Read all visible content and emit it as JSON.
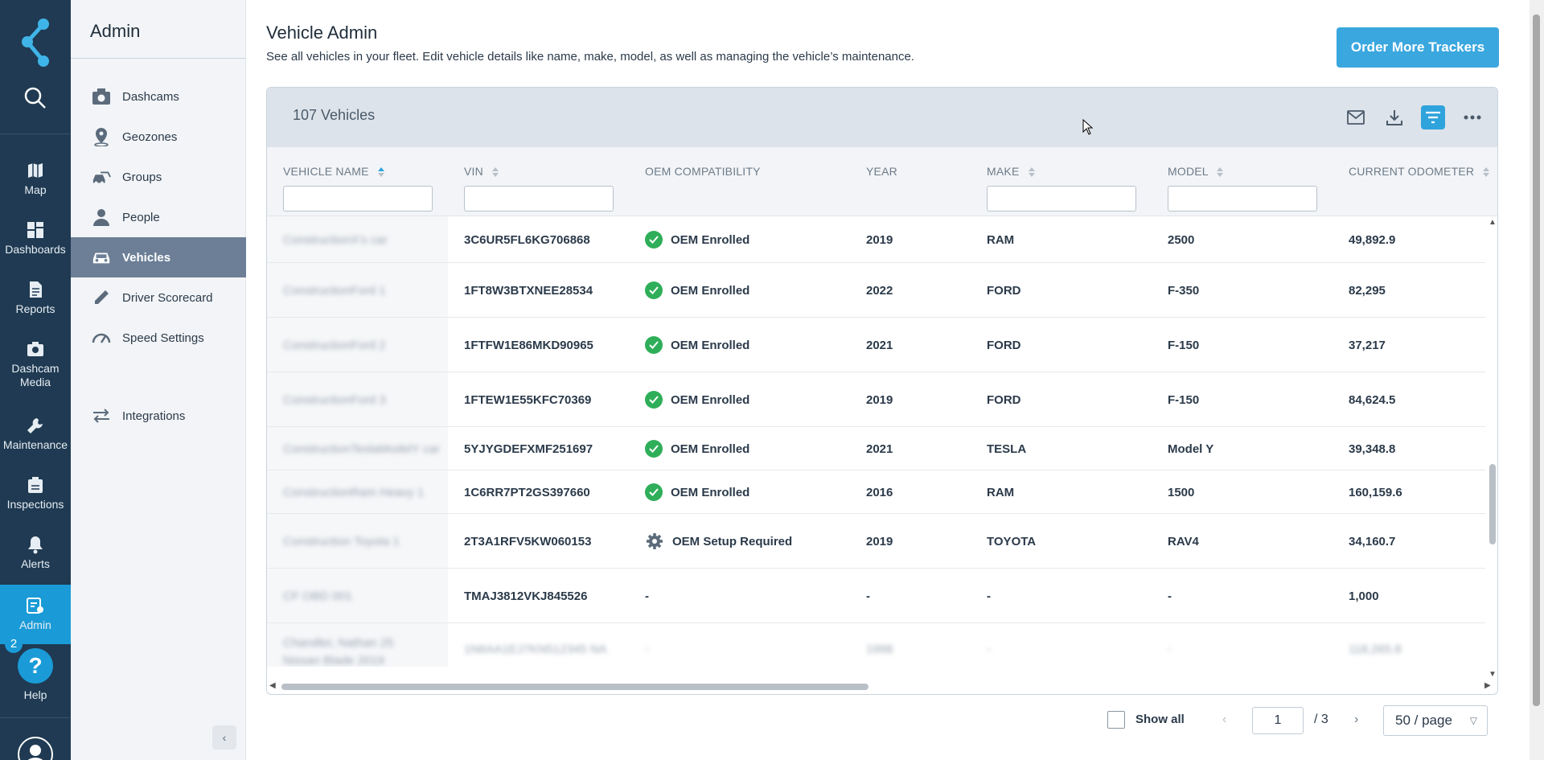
{
  "rail": {
    "items": [
      {
        "label": "Map",
        "icon": "map-icon"
      },
      {
        "label": "Dashboards",
        "icon": "dashboards-icon"
      },
      {
        "label": "Reports",
        "icon": "reports-icon"
      },
      {
        "label": "Dashcam Media",
        "icon": "camera-icon"
      },
      {
        "label": "Maintenance",
        "icon": "wrench-icon"
      },
      {
        "label": "Inspections",
        "icon": "clipboard-icon"
      },
      {
        "label": "Alerts",
        "icon": "bell-icon"
      },
      {
        "label": "Admin",
        "icon": "admin-icon"
      }
    ],
    "badge": "2",
    "help_label": "Help",
    "help_glyph": "?",
    "active_color": "#1a9bd7"
  },
  "sidebar": {
    "title": "Admin",
    "items": [
      {
        "label": "Dashcams",
        "icon": "camera-icon"
      },
      {
        "label": "Geozones",
        "icon": "pin-icon"
      },
      {
        "label": "Groups",
        "icon": "groups-icon"
      },
      {
        "label": "People",
        "icon": "person-icon"
      },
      {
        "label": "Vehicles",
        "icon": "car-icon"
      },
      {
        "label": "Driver Scorecard",
        "icon": "pen-icon"
      },
      {
        "label": "Speed Settings",
        "icon": "gauge-icon"
      },
      {
        "label": "Integrations",
        "icon": "arrows-icon"
      }
    ],
    "collapse_glyph": "‹"
  },
  "page": {
    "title": "Vehicle Admin",
    "subtitle": "See all vehicles in your fleet. Edit vehicle details like name, make, model, as well as managing the vehicle’s maintenance.",
    "order_button": "Order More Trackers"
  },
  "table": {
    "count_label": "107 Vehicles",
    "columns": [
      "VEHICLE NAME",
      "VIN",
      "OEM COMPATIBILITY",
      "YEAR",
      "MAKE",
      "MODEL",
      "CURRENT ODOMETER"
    ],
    "rows": [
      {
        "name": "ConstructionX's car",
        "vin": "3C6UR5FL6KG706868",
        "oem": "OEM Enrolled",
        "oem_status": "enrolled",
        "year": "2019",
        "make": "RAM",
        "model": "2500",
        "odometer": "49,892.9"
      },
      {
        "name": "ConstructionFord 1",
        "vin": "1FT8W3BTXNEE28534",
        "oem": "OEM Enrolled",
        "oem_status": "enrolled",
        "year": "2022",
        "make": "FORD",
        "model": "F-350",
        "odometer": "82,295"
      },
      {
        "name": "ConstructionFord 2",
        "vin": "1FTFW1E86MKD90965",
        "oem": "OEM Enrolled",
        "oem_status": "enrolled",
        "year": "2021",
        "make": "FORD",
        "model": "F-150",
        "odometer": "37,217"
      },
      {
        "name": "ConstructionFord 3",
        "vin": "1FTEW1E55KFC70369",
        "oem": "OEM Enrolled",
        "oem_status": "enrolled",
        "year": "2019",
        "make": "FORD",
        "model": "F-150",
        "odometer": "84,624.5"
      },
      {
        "name": "ConstructionTeslaModelY car",
        "vin": "5YJYGDEFXMF251697",
        "oem": "OEM Enrolled",
        "oem_status": "enrolled",
        "year": "2021",
        "make": "TESLA",
        "model": "Model Y",
        "odometer": "39,348.8"
      },
      {
        "name": "ConstructionRam Heavy 1",
        "vin": "1C6RR7PT2GS397660",
        "oem": "OEM Enrolled",
        "oem_status": "enrolled",
        "year": "2016",
        "make": "RAM",
        "model": "1500",
        "odometer": "160,159.6"
      },
      {
        "name": "Construction Toyota 1",
        "vin": "2T3A1RFV5KW060153",
        "oem": "OEM Setup Required",
        "oem_status": "setup",
        "year": "2019",
        "make": "TOYOTA",
        "model": "RAV4",
        "odometer": "34,160.7"
      },
      {
        "name": "CF OBD 001",
        "vin": "TMAJ3812VKJ845526",
        "oem": "-",
        "oem_status": "none",
        "year": "-",
        "make": "-",
        "model": "-",
        "odometer": "1,000"
      },
      {
        "name": "Chandler, Nathan 25 Nissan Blade 2019",
        "vin": "1N6AA1EJ7KN512345 NA",
        "oem": "-",
        "oem_status": "blur",
        "year": "1998",
        "make": "-",
        "model": "-",
        "odometer": "118,265.8"
      }
    ]
  },
  "pagination": {
    "show_all": "Show all",
    "prev": "‹",
    "page": "1",
    "of": "/ 3",
    "next": "›",
    "per_page": "50 / page"
  }
}
